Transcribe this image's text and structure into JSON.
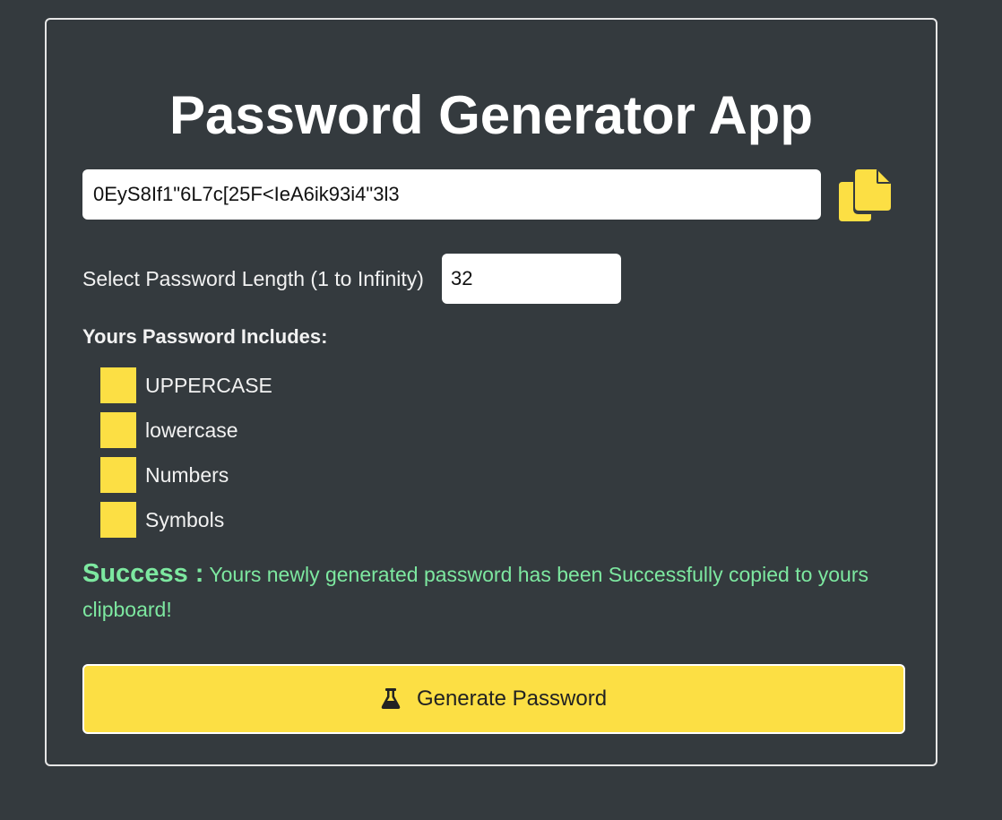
{
  "app": {
    "title": "Password Generator App"
  },
  "password": {
    "value": "0EyS8If1\"6L7c[25F<IeA6ik93i4\"3l3"
  },
  "length": {
    "label": "Select Password Length (1 to Infinity)",
    "value": "32"
  },
  "includes": {
    "label": "Yours Password Includes:",
    "options": [
      {
        "label": "UPPERCASE"
      },
      {
        "label": "lowercase"
      },
      {
        "label": "Numbers"
      },
      {
        "label": "Symbols"
      }
    ]
  },
  "message": {
    "title": "Success :",
    "text": "Yours newly generated password has been Successfully copied to yours clipboard!"
  },
  "generate_button": {
    "label": "Generate Password",
    "icon": "flask-icon"
  },
  "copy_button": {
    "icon": "copy-icon"
  },
  "colors": {
    "background": "#343a3e",
    "accent": "#fcdf44",
    "success": "#7de8a0",
    "border": "#e6e6e6"
  }
}
